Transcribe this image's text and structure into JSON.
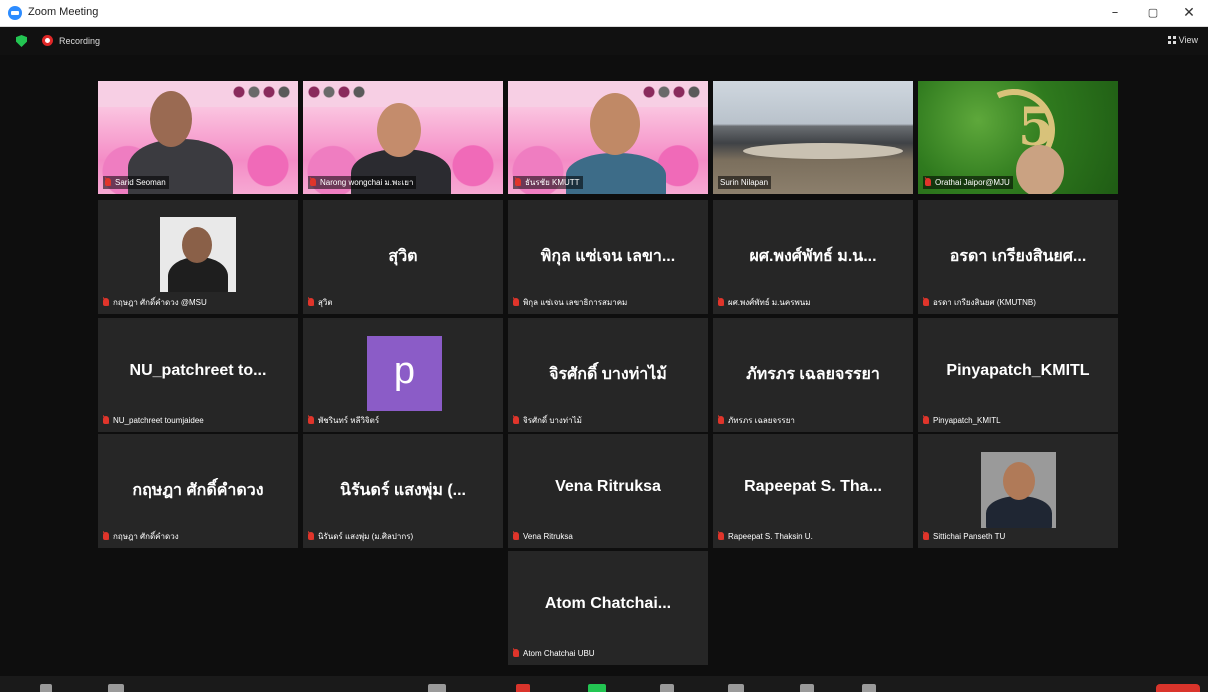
{
  "window": {
    "title": "Zoom Meeting",
    "min": "–",
    "max": "▢",
    "close": "✕"
  },
  "topbar": {
    "recording": "Recording",
    "view": "View"
  },
  "tiles": [
    {
      "label": "Sarid Seoman",
      "type": "video-pink"
    },
    {
      "label": "Narong wongchai ม.พะเยา",
      "type": "video-pink"
    },
    {
      "label": "ธันรชัย KMUTT",
      "type": "video-pink"
    },
    {
      "label": "Surin Nilapan",
      "type": "video-meeting"
    },
    {
      "label": "Orathai Jaipor@MJU",
      "type": "video-green"
    },
    {
      "label": "กฤษฎา ศักดิ์คำดวง @MSU",
      "type": "photo"
    },
    {
      "name": "สุวิต",
      "label": "สุวิต",
      "type": "name"
    },
    {
      "name": "พิกุล แซ่เจน เลขา...",
      "label": "พิกุล แซ่เจน เลขาธิการสมาคม",
      "type": "name"
    },
    {
      "name": "ผศ.พงศ์พัทธ์ ม.น...",
      "label": "ผศ.พงศ์พัทธ์ ม.นครพนม",
      "type": "name"
    },
    {
      "name": "อรดา เกรียงสินยศ...",
      "label": "อรดา เกรียงสินยศ (KMUTNB)",
      "type": "name"
    },
    {
      "name": "NU_patchreet to...",
      "label": "NU_patchreet toumjaidee",
      "type": "name"
    },
    {
      "avatar": "p",
      "label": "พัชรินทร์ หลีวิจิตร์",
      "type": "avatar"
    },
    {
      "name": "จิรศักดิ์ บางท่าไม้",
      "label": "จิรศักดิ์ บางท่าไม้",
      "type": "name"
    },
    {
      "name": "ภัทรภร เฉลยจรรยา",
      "label": "ภัทรภร เฉลยจรรยา",
      "type": "name"
    },
    {
      "name": "Pinyapatch_KMITL",
      "label": "Pinyapatch_KMITL",
      "type": "name"
    },
    {
      "name": "กฤษฎา ศักดิ์คำดวง",
      "label": "กฤษฎา ศักดิ์คำดวง",
      "type": "name"
    },
    {
      "name": "นิรันดร์ แสงพุ่ม (...",
      "label": "นิรันดร์ แสงพุ่ม (ม.ศิลปากร)",
      "type": "name"
    },
    {
      "name": "Vena Ritruksa",
      "label": "Vena Ritruksa",
      "type": "name"
    },
    {
      "name": "Rapeepat S. Tha...",
      "label": "Rapeepat S. Thaksin U.",
      "type": "name"
    },
    {
      "label": "Sittichai Panseth TU",
      "type": "photo"
    },
    {
      "name": "Atom Chatchai...",
      "label": "Atom Chatchai UBU",
      "type": "name"
    }
  ],
  "colors": {
    "background": "#0e0e0e",
    "tile": "#262626",
    "active_speaker_border": "#d6e23c",
    "mic_off": "#e0352b",
    "avatar_purple": "#8b5cc7",
    "recording_red": "#e02828",
    "shield_green": "#23c552"
  }
}
